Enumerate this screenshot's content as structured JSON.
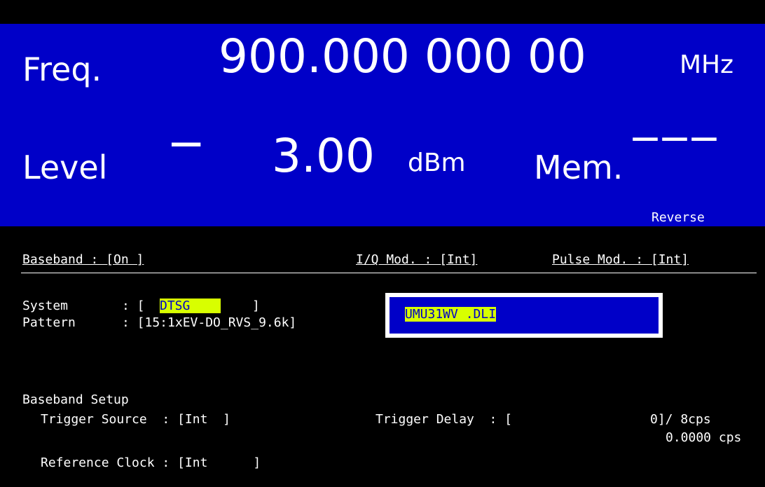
{
  "header": {
    "freq_label": "Freq.",
    "freq_value": "900.000 000 00",
    "freq_unit": "MHz",
    "level_label": "Level",
    "level_sign": "−",
    "level_value": "3.00",
    "level_unit": "dBm",
    "mem_label": "Mem.",
    "mem_value": "‒‒‒",
    "mode_text": "Reverse"
  },
  "status_row": {
    "baseband": "Baseband : [On ]",
    "iq_mod": "I/Q Mod. : [Int]",
    "pulse_mod": "Pulse Mod. : [Int]"
  },
  "system": {
    "label": "System",
    "sep": ": [",
    "value": "DTSG    ",
    "close": "]"
  },
  "pattern": {
    "label": "Pattern",
    "text": ": [15:1xEV-DO_RVS_9.6k]"
  },
  "popup": {
    "selected_file": "UMU31WV .DLI"
  },
  "baseband_setup": {
    "title": "Baseband Setup",
    "trigger_source": "Trigger Source  : [Int  ]",
    "trigger_delay": "Trigger Delay  : [",
    "trigger_delay_value": "0]/ 8cps",
    "trigger_delay_cps": "0.0000 cps",
    "reference_clock": "Reference Clock : [Int      ]"
  },
  "colors": {
    "background": "#000000",
    "panel_blue": "#0000c8",
    "highlight": "#d8ff00",
    "text": "#ffffff"
  }
}
